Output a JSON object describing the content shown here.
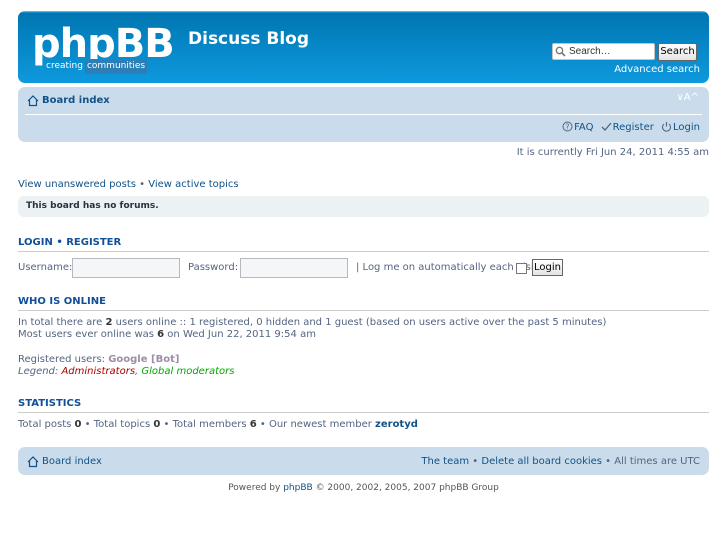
{
  "header": {
    "logo_text": "phpBB",
    "logo_tag_1": "creating",
    "logo_tag_2": "communities",
    "site_title": "Discuss Blog",
    "search_placeholder": "Search…",
    "search_button": "Search",
    "advanced_search": "Advanced search"
  },
  "navbar": {
    "board_index": "Board index",
    "font_size": "∨A^",
    "faq": "FAQ",
    "register": "Register",
    "login": "Login"
  },
  "current_time": "It is currently Fri Jun 24, 2011 4:55 am",
  "topic_links": {
    "unanswered": "View unanswered posts",
    "separator": "•",
    "active": "View active topics"
  },
  "no_forums": "This board has no forums.",
  "login_section": {
    "login": "LOGIN",
    "separator": "•",
    "register": "REGISTER",
    "username_label": "Username:",
    "password_label": "Password:",
    "autologin_label": "| Log me on automatically each visit",
    "login_button": "Login"
  },
  "who_is_online": {
    "heading": "WHO IS ONLINE",
    "line1_prefix": "In total there are ",
    "users_online": "2",
    "line1_suffix": " users online :: 1 registered, 0 hidden and 1 guest (based on users active over the past 5 minutes)",
    "line2_prefix": "Most users ever online was ",
    "max_users": "6",
    "line2_suffix": " on Wed Jun 22, 2011 9:54 am",
    "registered_label": "Registered users: ",
    "registered_user": "Google [Bot]",
    "legend_label": "Legend: ",
    "legend_admins": "Administrators",
    "legend_sep": ", ",
    "legend_gmods": "Global moderators"
  },
  "statistics": {
    "heading": "STATISTICS",
    "posts_label": "Total posts ",
    "posts": "0",
    "topics_label": " • Total topics ",
    "topics": "0",
    "members_label": " • Total members ",
    "members": "6",
    "newest_label": " • Our newest member ",
    "newest_member": "zerotyd"
  },
  "footer": {
    "board_index": "Board index",
    "the_team": "The team",
    "sep": " • ",
    "delete_cookies": "Delete all board cookies",
    "times": "All times are UTC"
  },
  "copyright": {
    "prefix": "Powered by ",
    "phpbb": "phpBB",
    "suffix": " © 2000, 2002, 2005, 2007 phpBB Group"
  },
  "colors": {
    "header_blue": "#12a3eb",
    "nav_bg": "#cadceb",
    "link": "#105289",
    "admin": "#aa0000",
    "gmod": "#00aa00"
  }
}
